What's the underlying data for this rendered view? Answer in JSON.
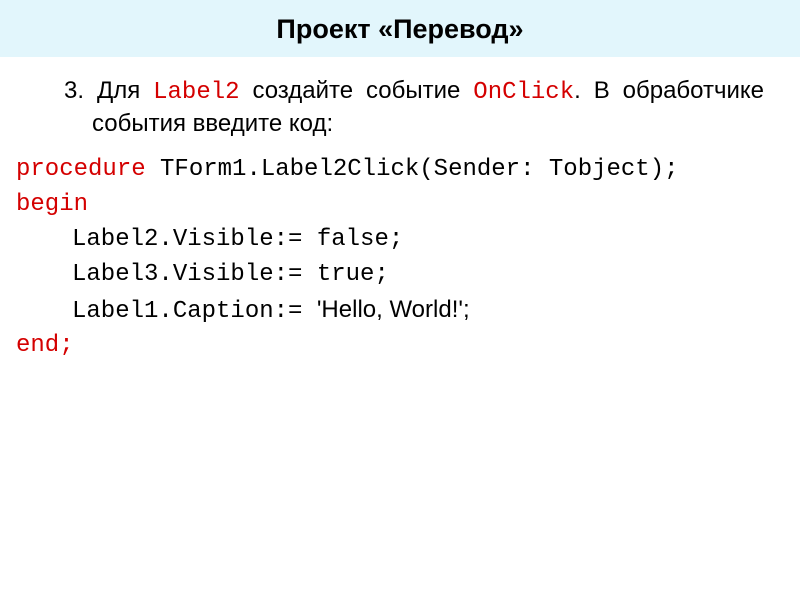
{
  "title": "Проект «Перевод»",
  "instruction": {
    "number": "3.",
    "p1a": "Для ",
    "label_ref": "Label2",
    "p1b": " создайте событие ",
    "event_ref": "OnClick",
    "p1c": ". В обработчике события введите код:"
  },
  "code": {
    "l1a": "procedure",
    "l1b": " TForm1.Label2Click(Sender: Tobject);",
    "l2": "begin",
    "l3": "Label2.Visible:= false;",
    "l4": "Label3.Visible:= true;",
    "l5a": "Label1.Caption:= ",
    "l5b": "'Hello, World!';",
    "l6": "end;"
  }
}
